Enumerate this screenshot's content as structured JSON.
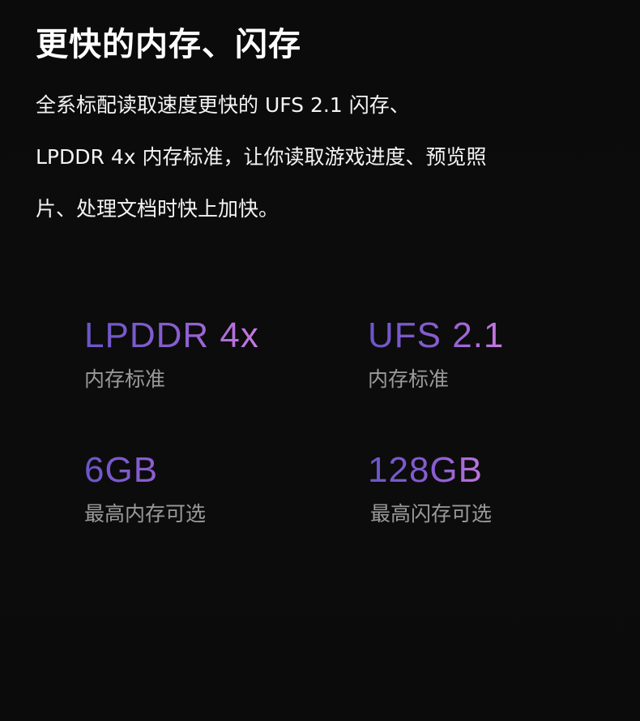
{
  "heading": "更快的内存、闪存",
  "description": {
    "lines": [
      "全系标配读取速度更快的 UFS 2.1 闪存、",
      "LPDDR 4x 内存标准，让你读取游戏进度、预览照",
      "片、处理文档时快上加快。"
    ]
  },
  "specs": [
    {
      "value": "LPDDR 4x",
      "label": "内存标准"
    },
    {
      "value": "UFS 2.1",
      "label": "内存标准"
    },
    {
      "value": "6GB",
      "label": "最高内存可选"
    },
    {
      "value": "128GB",
      "label": "最高闪存可选"
    }
  ],
  "colors": {
    "background": "#0c0b0c",
    "heading_text": "#ffffff",
    "body_text": "#f4f4f4",
    "label_text": "#9a9a9a",
    "gradient_start": "#6b56c8",
    "gradient_end": "#c87ae0"
  }
}
